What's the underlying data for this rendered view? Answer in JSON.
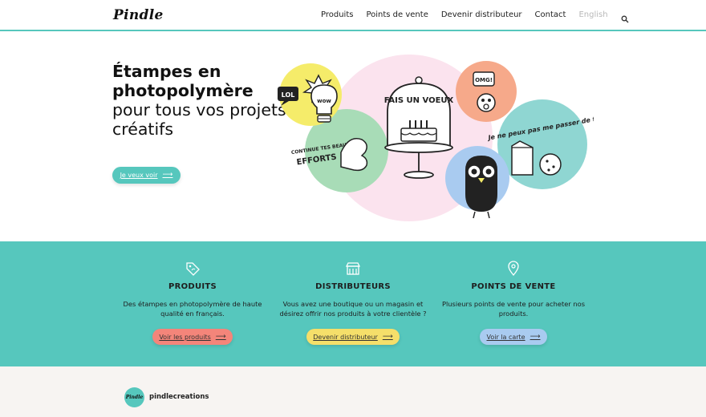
{
  "header": {
    "logo": "Pindle",
    "nav": [
      {
        "label": "Produits"
      },
      {
        "label": "Points de vente"
      },
      {
        "label": "Devenir distributeur"
      },
      {
        "label": "Contact"
      },
      {
        "label": "English"
      }
    ],
    "search_icon": "search-icon"
  },
  "hero": {
    "title_bold": "Étampes en photopolymère",
    "title_light": "pour tous vos projets créatifs",
    "cta_label": "Je veux voir",
    "stickers": {
      "lol": "LOL",
      "wow": "wow",
      "omg": "OMG!",
      "fais_un_voeux": "FAIS UN VOEUX",
      "continue": "CONTINUE TES BEAUX",
      "efforts": "EFFORTS",
      "passer": "Je ne peux pas me passer de toi"
    }
  },
  "features": [
    {
      "icon": "price-tag-icon",
      "title": "PRODUITS",
      "text": "Des étampes en photopolymère de haute qualité en français.",
      "button": "Voir les produits",
      "color": "#f4857a"
    },
    {
      "icon": "storefront-icon",
      "title": "DISTRIBUTEURS",
      "text": "Vous avez une boutique ou un magasin et désirez offrir nos produits à votre clientèle ?",
      "button": "Devenir distributeur",
      "color": "#f5df6a"
    },
    {
      "icon": "map-pin-icon",
      "title": "POINTS DE VENTE",
      "text": "Plusieurs points de vente pour acheter nos produits.",
      "button": "Voir la carte",
      "color": "#a9cbf0"
    }
  ],
  "instagram": {
    "avatar_text": "Pindle",
    "handle": "pindlecreations"
  },
  "colors": {
    "teal": "#56c7bd",
    "pink": "#fbe3ee",
    "yellow": "#f5ec6a",
    "green": "#a8dcb7",
    "salmon": "#f6a98a",
    "blue": "#a9cbf0"
  }
}
